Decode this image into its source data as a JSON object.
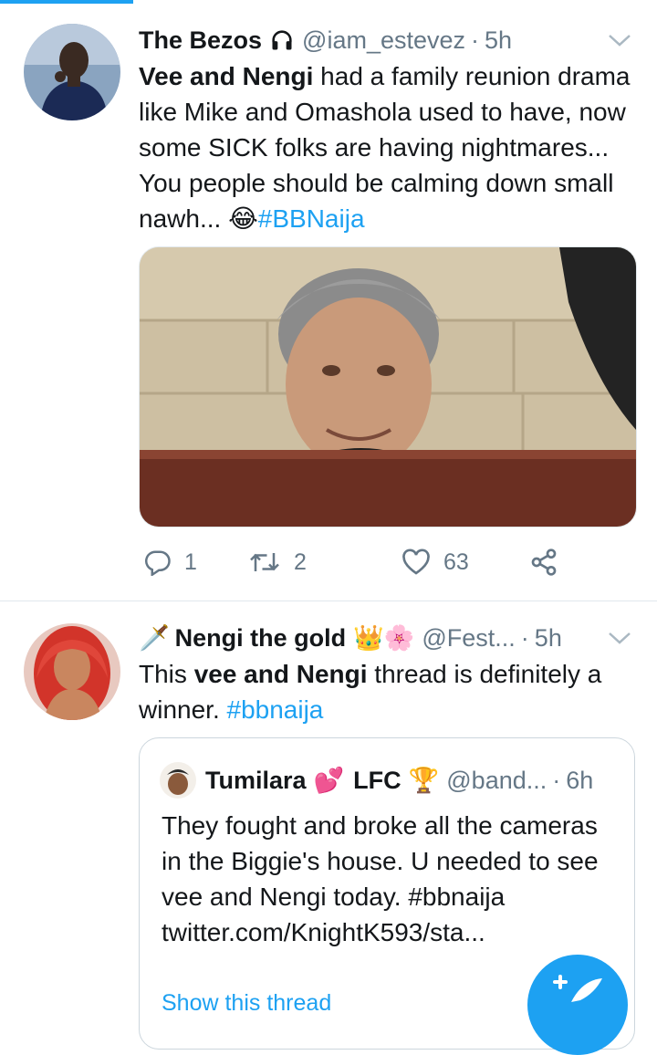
{
  "tweet1": {
    "name": "The Bezos",
    "name_icon": "headphones-icon",
    "handle": "@iam_estevez",
    "separator": "·",
    "time": "5h",
    "text_bold": "Vee and Nengi",
    "text_rest": " had a family reunion drama like Mike and Omashola used to have, now some SICK folks are having nightmares... You people should be calming down small nawh... ",
    "emoji": "😂",
    "hashtag": "#BBNaija",
    "replies": "1",
    "retweets": "2",
    "likes": "63"
  },
  "tweet2": {
    "name_prefix_emoji": "🗡️",
    "name": "Nengi the gold",
    "name_suffix_emoji": "👑🌸",
    "handle": "@Fest...",
    "separator": "·",
    "time": "5h",
    "text_start": "This ",
    "text_bold": "vee and Nengi",
    "text_rest": " thread is definitely a winner. ",
    "hashtag": "#bbnaija",
    "quote": {
      "name": "Tumilara",
      "name_emoji": "💕",
      "team": "LFC",
      "team_emoji": "🏆",
      "handle": "@band...",
      "separator": "·",
      "time": "6h",
      "text": "They fought and broke all the cameras in the Biggie's house. U needed to see vee and Nengi today. #bbnaija twitter.com/KnightK593/sta...",
      "show_thread": "Show this thread"
    }
  },
  "colors": {
    "accent": "#1da1f2",
    "secondary_text": "#657786",
    "divider": "#e1e8ed"
  },
  "icons": [
    "reply-icon",
    "retweet-icon",
    "like-icon",
    "share-icon",
    "chevron-down-icon",
    "compose-icon"
  ]
}
